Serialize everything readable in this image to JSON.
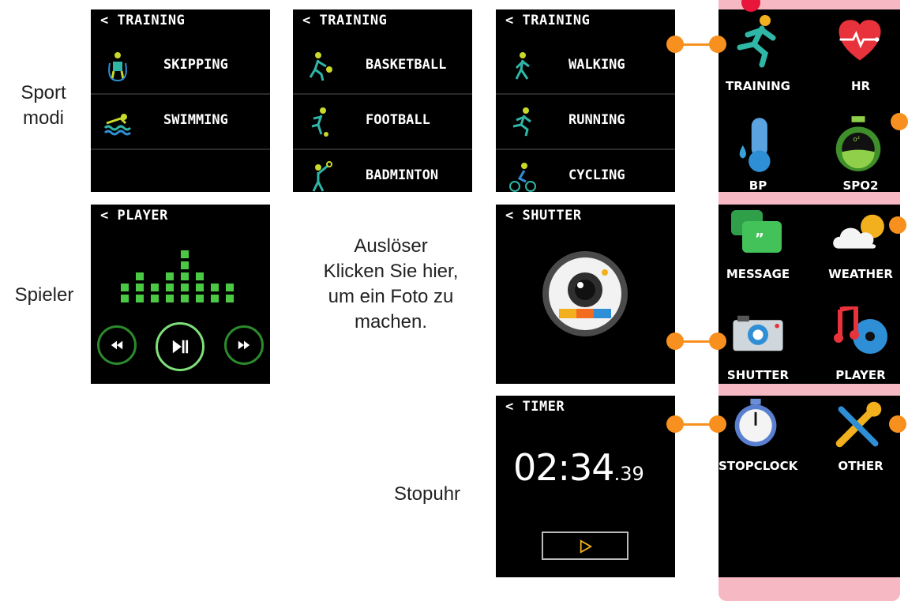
{
  "training_screens": [
    {
      "header": "< TRAINING",
      "items": [
        "SKIPPING",
        "SWIMMING"
      ]
    },
    {
      "header": "< TRAINING",
      "items": [
        "BASKETBALL",
        "FOOTBALL",
        "BADMINTON"
      ]
    },
    {
      "header": "< TRAINING",
      "items": [
        "WALKING",
        "RUNNING",
        "CYCLING"
      ]
    }
  ],
  "player_screen": {
    "header": "< PLAYER",
    "eq_levels": [
      2,
      3,
      2,
      3,
      5,
      3,
      2,
      2
    ]
  },
  "shutter_screen": {
    "header": "< SHUTTER"
  },
  "timer_screen": {
    "header": "< TIMER",
    "time_main": "02:34",
    "time_fraction": ".39"
  },
  "side_labels": {
    "sport": [
      "Sport",
      "modi"
    ],
    "player": "Spieler",
    "shutter": [
      "Auslöser",
      "Klicken Sie hier,",
      "um ein Foto zu",
      "machen."
    ],
    "timer": "Stopuhr"
  },
  "menu_tiles": [
    {
      "label": "TRAINING",
      "icon": "runner-icon"
    },
    {
      "label": "HR",
      "icon": "heart-rate-icon"
    },
    {
      "label": "BP",
      "icon": "thermometer-icon"
    },
    {
      "label": "SPO2",
      "icon": "spo2-flask-icon"
    },
    {
      "label": "MESSAGE",
      "icon": "message-icon"
    },
    {
      "label": "WEATHER",
      "icon": "weather-icon"
    },
    {
      "label": "SHUTTER",
      "icon": "camera-icon"
    },
    {
      "label": "PLAYER",
      "icon": "music-icon"
    },
    {
      "label": "STOPCLOCK",
      "icon": "stopwatch-icon"
    },
    {
      "label": "OTHER",
      "icon": "tools-icon"
    }
  ],
  "colors": {
    "accent": "#f7901e",
    "band": "#f6b9c4",
    "screen": "#000000",
    "eq": "#4cc944",
    "marker": "#e8163a"
  }
}
